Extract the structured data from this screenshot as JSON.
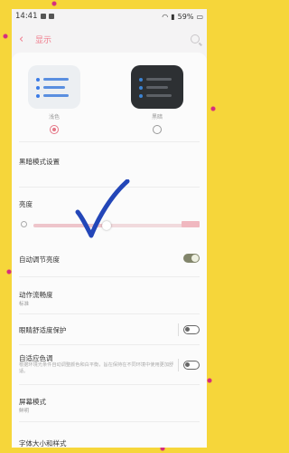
{
  "status_bar": {
    "time": "14:41",
    "battery": "59%"
  },
  "header": {
    "title": "显示"
  },
  "themes": [
    {
      "label": "浅色",
      "selected": true
    },
    {
      "label": "黑暗",
      "selected": false
    }
  ],
  "settings": {
    "dark_mode": "黑暗模式设置",
    "brightness": "亮度",
    "brightness_level": 0.48,
    "auto_brightness": "自动调节亮度",
    "auto_brightness_on": true,
    "motion_smoothness": {
      "label": "动作流畅度",
      "value": "标准"
    },
    "eye_comfort": "眼睛舒适度保护",
    "eye_comfort_on": false,
    "adaptive_color": {
      "label": "自适应色调",
      "desc": "根据环境光条件自动调整颜色和白平衡，旨在保持在不同环境中使用更加舒适。"
    },
    "adaptive_color_on": false,
    "screen_mode": {
      "label": "屏幕模式",
      "value": "鲜明"
    },
    "font": "字体大小和样式"
  },
  "annotation": {
    "color": "#2346b8"
  },
  "colors": {
    "accent": "#e57787",
    "toggle_on": "#82856b",
    "frame": "#f6d63a"
  }
}
